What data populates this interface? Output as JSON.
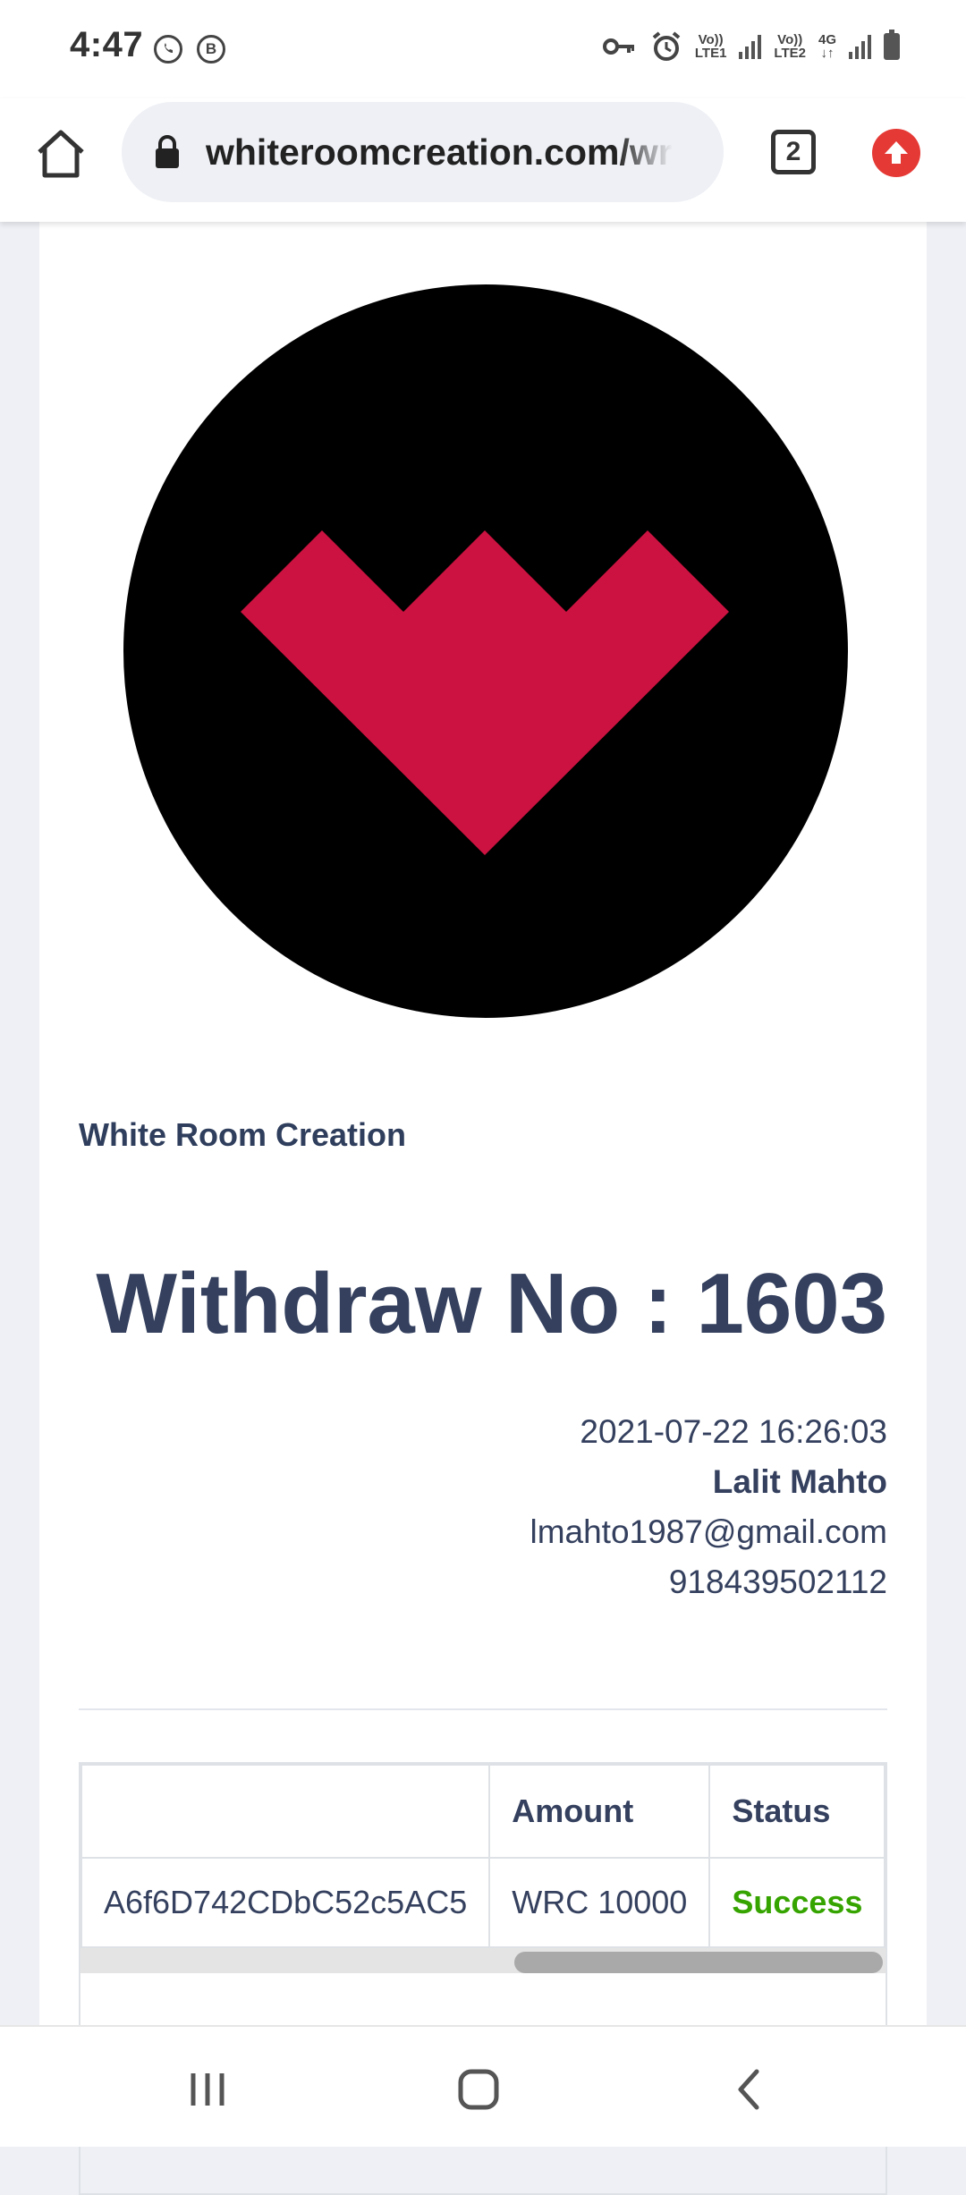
{
  "status_bar": {
    "time": "4:47",
    "app_icons": [
      "whatsapp-icon",
      "business-b-icon"
    ],
    "business_letter": "B",
    "sim1_label": [
      "Vo))",
      "LTE1"
    ],
    "sim2_label": [
      "Vo))",
      "LTE2"
    ],
    "network_type": "4G"
  },
  "browser": {
    "url": "whiteroomcreation.com/wr",
    "tab_count": "2"
  },
  "page": {
    "company_name": "White Room Creation",
    "withdraw_title": "Withdraw No : 1603",
    "datetime": "2021-07-22 16:26:03",
    "customer_name": "Lalit Mahto",
    "email": "lmahto1987@gmail.com",
    "phone": "918439502112",
    "logo_colors": {
      "background": "#000000",
      "heart": "#cc1240"
    }
  },
  "table": {
    "headers": [
      "",
      "Amount",
      "Status"
    ],
    "rows": [
      {
        "address": "A6f6D742CDbC52c5AC5",
        "amount": "WRC 10000",
        "status": "Success"
      }
    ],
    "status_color": "#36a400"
  }
}
